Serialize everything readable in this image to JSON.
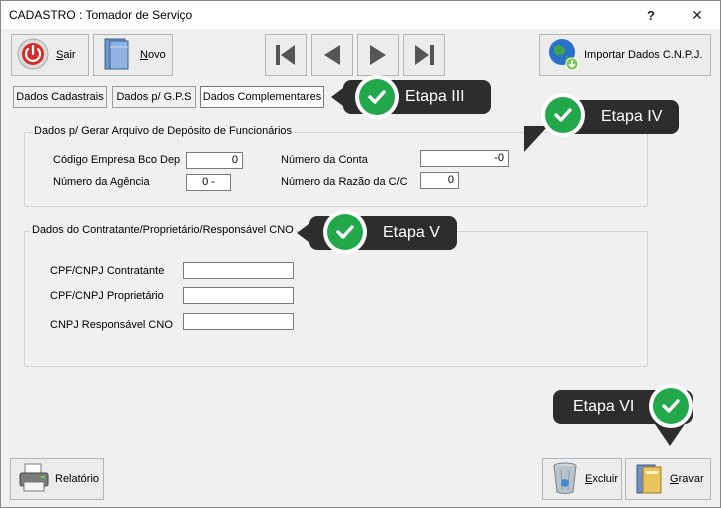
{
  "window": {
    "title": "CADASTRO : Tomador de Serviço",
    "help": "?",
    "close": "✕"
  },
  "toolbar": {
    "sair_accel": "S",
    "sair_rest": "air",
    "novo_accel": "N",
    "novo_rest": "ovo",
    "importar_label": "Importar Dados C.N.P.J."
  },
  "tabs": [
    {
      "label": "Dados Cadastrais"
    },
    {
      "label": "Dados p/ G.P.S"
    },
    {
      "label": "Dados Complementares"
    }
  ],
  "group1": {
    "legend": "Dados p/ Gerar Arquivo de Depósito de Funcionários",
    "codigo_label": "Código Empresa Bco Dep",
    "codigo_value": "0",
    "agencia_label": "Número da Agência",
    "agencia_value": "0  -",
    "conta_label": "Número da Conta",
    "conta_value": "-0",
    "razao_label": "Número da Razão da C/C",
    "razao_value": "0"
  },
  "group2": {
    "legend": "Dados do Contratante/Proprietário/Responsável CNO",
    "contratante_label": "CPF/CNPJ Contratante",
    "contratante_value": "",
    "proprietario_label": "CPF/CNPJ Proprietário",
    "proprietario_value": "",
    "cno_label": "CNPJ Responsável CNO",
    "cno_value": ""
  },
  "footer": {
    "relatorio_label": "Relatório",
    "excluir_accel": "E",
    "excluir_rest": "xcluir",
    "gravar_accel": "G",
    "gravar_rest": "ravar"
  },
  "callouts": {
    "etapa3": "Etapa III",
    "etapa4": "Etapa IV",
    "etapa5": "Etapa V",
    "etapa6": "Etapa VI"
  },
  "colors": {
    "callout_bg": "#2d2d2d",
    "check_green": "#22a84a"
  }
}
